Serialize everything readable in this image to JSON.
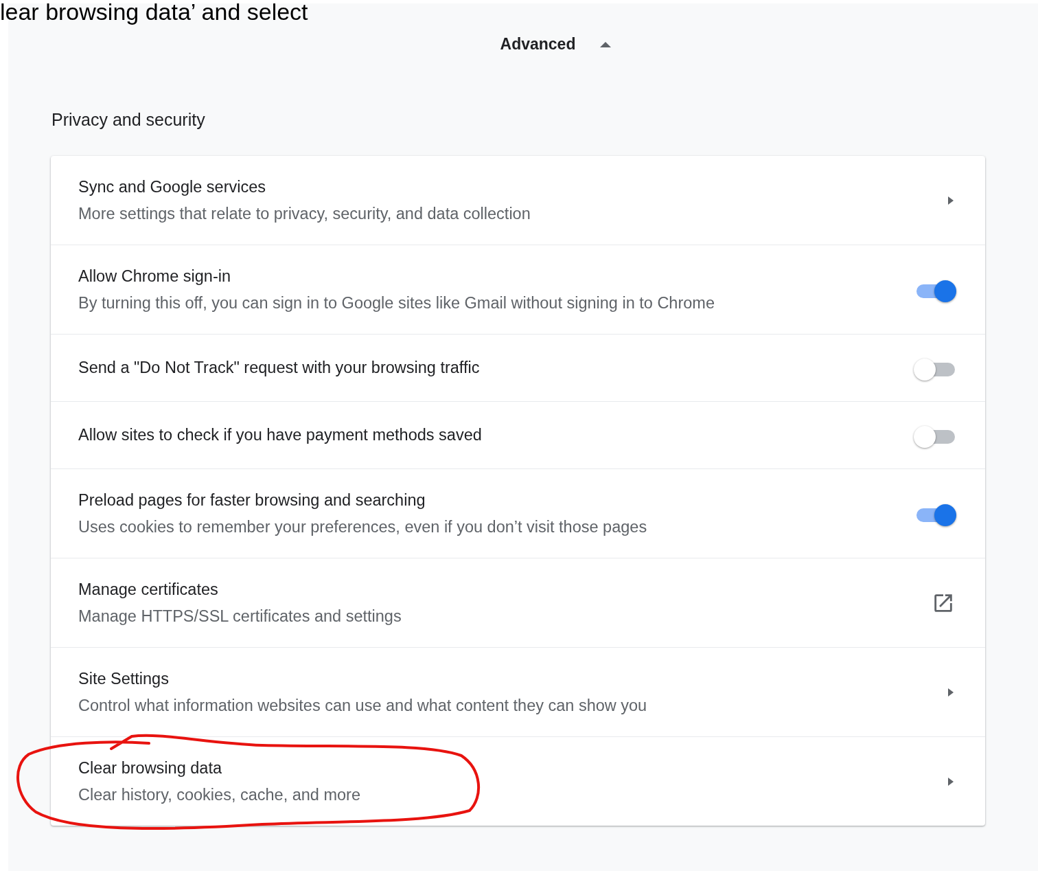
{
  "caption": "lear browsing data’ and select",
  "advanced": {
    "label": "Advanced",
    "expanded": true
  },
  "section_title": "Privacy and security",
  "rows": [
    {
      "kind": "arrow",
      "title": "Sync and Google services",
      "subtitle": "More settings that relate to privacy, security, and data collection"
    },
    {
      "kind": "toggle",
      "title": "Allow Chrome sign-in",
      "subtitle": "By turning this off, you can sign in to Google sites like Gmail without signing in to Chrome",
      "on": true
    },
    {
      "kind": "toggle",
      "title": "Send a \"Do Not Track\" request with your browsing traffic",
      "on": false
    },
    {
      "kind": "toggle",
      "title": "Allow sites to check if you have payment methods saved",
      "on": false
    },
    {
      "kind": "toggle",
      "title": "Preload pages for faster browsing and searching",
      "subtitle": "Uses cookies to remember your preferences, even if you don’t visit those pages",
      "on": true
    },
    {
      "kind": "external",
      "title": "Manage certificates",
      "subtitle": "Manage HTTPS/SSL certificates and settings"
    },
    {
      "kind": "arrow",
      "title": "Site Settings",
      "subtitle": "Control what information websites can use and what content they can show you"
    },
    {
      "kind": "arrow",
      "title": "Clear browsing data",
      "subtitle": "Clear history, cookies, cache, and more"
    }
  ]
}
